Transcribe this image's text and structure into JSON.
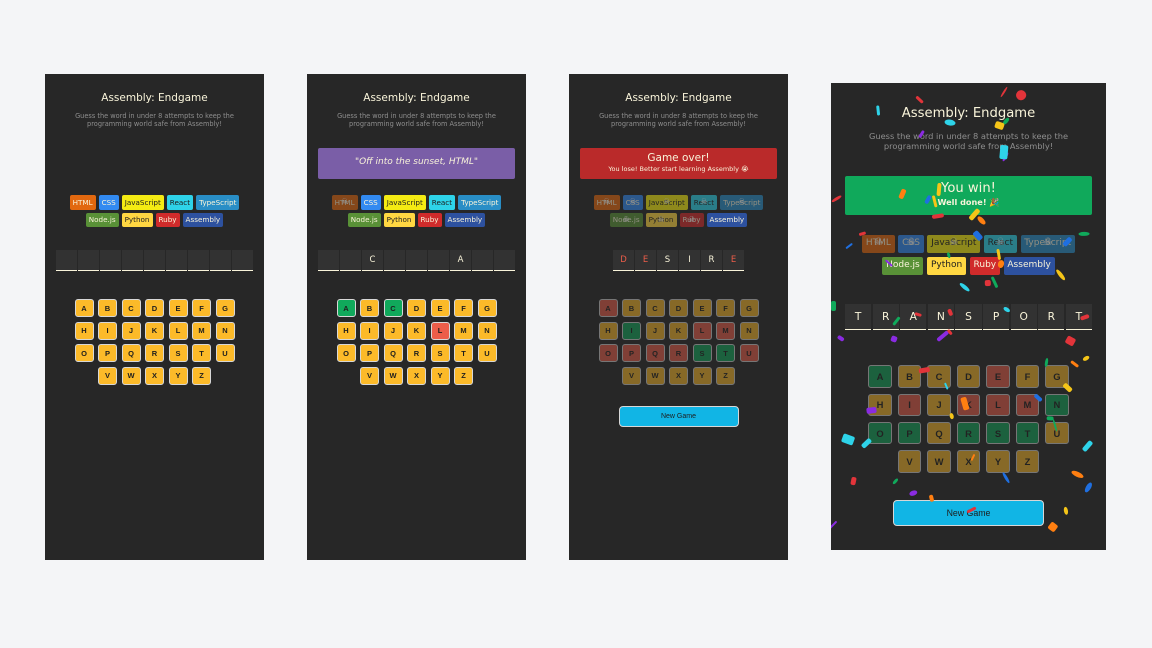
{
  "colors": {
    "background": "#f4f5f7",
    "panel": "#272727",
    "key": "#fcba29",
    "correct": "#10a95b",
    "wrong": "#ec5d49",
    "button": "#11b5e5"
  },
  "languages": [
    {
      "name": "HTML",
      "bg": "#e2680f",
      "fg": "#f9f4da"
    },
    {
      "name": "CSS",
      "bg": "#328af1",
      "fg": "#f9f4da"
    },
    {
      "name": "JavaScript",
      "bg": "#f4eb13",
      "fg": "#1e1e1e"
    },
    {
      "name": "React",
      "bg": "#2ed3e9",
      "fg": "#1e1e1e"
    },
    {
      "name": "TypeScript",
      "bg": "#298ec6",
      "fg": "#f9f4da"
    },
    {
      "name": "Node.js",
      "bg": "#599137",
      "fg": "#f9f4da"
    },
    {
      "name": "Python",
      "bg": "#ffd742",
      "fg": "#1e1e1e"
    },
    {
      "name": "Ruby",
      "bg": "#d02b2b",
      "fg": "#f9f4da"
    },
    {
      "name": "Assembly",
      "bg": "#2d519f",
      "fg": "#f9f4da"
    }
  ],
  "skull_icon": "skull-icon",
  "screens": [
    {
      "title": "Assembly: Endgame",
      "subtitle": "Guess the word in under 8 attempts to keep the programming world safe from Assembly!",
      "banner": null,
      "lost_count": 0,
      "word": [
        "",
        "",
        "",
        "",
        "",
        "",
        "",
        "",
        ""
      ],
      "word_miss": [],
      "correct_keys": [],
      "wrong_keys": [],
      "dimmed": false,
      "new_game": null
    },
    {
      "title": "Assembly: Endgame",
      "subtitle": "Guess the word in under 8 attempts to keep the programming world safe from Assembly!",
      "banner": {
        "text": "\"Off into the sunset, HTML\"",
        "sub": "",
        "bg": "#7a5ea7",
        "italic": true
      },
      "lost_count": 1,
      "word": [
        "",
        "",
        "C",
        "",
        "",
        "",
        "A",
        "",
        ""
      ],
      "word_miss": [],
      "correct_keys": [
        "A",
        "C"
      ],
      "wrong_keys": [
        "L"
      ],
      "dimmed": false,
      "new_game": null
    },
    {
      "title": "Assembly: Endgame",
      "subtitle": "Guess the word in under 8 attempts to keep the programming world safe from Assembly!",
      "banner": {
        "text": "Game over!",
        "sub": "You lose! Better start learning Assembly 😭",
        "bg": "#ba2a2a",
        "italic": false
      },
      "lost_count": 8,
      "word": [
        "D",
        "E",
        "S",
        "I",
        "R",
        "E"
      ],
      "word_miss": [
        0,
        1,
        5
      ],
      "correct_keys": [
        "I",
        "S",
        "T"
      ],
      "wrong_keys": [
        "A",
        "L",
        "M",
        "O",
        "P",
        "Q",
        "R",
        "U"
      ],
      "dimmed": true,
      "new_game": "New Game"
    },
    {
      "title": "Assembly: Endgame",
      "subtitle": "Guess the word in under 8 attempts to keep the programming world safe from Assembly!",
      "banner": {
        "text": "You win!",
        "sub": "Well done! 🎉",
        "bg": "#10a95b",
        "italic": false
      },
      "lost_count": 5,
      "word": [
        "T",
        "R",
        "A",
        "N",
        "S",
        "P",
        "O",
        "R",
        "T"
      ],
      "word_miss": [],
      "correct_keys": [
        "A",
        "N",
        "O",
        "P",
        "R",
        "S",
        "T"
      ],
      "wrong_keys": [
        "E",
        "I",
        "K",
        "L",
        "M"
      ],
      "dimmed": true,
      "new_game": "New Game"
    }
  ]
}
